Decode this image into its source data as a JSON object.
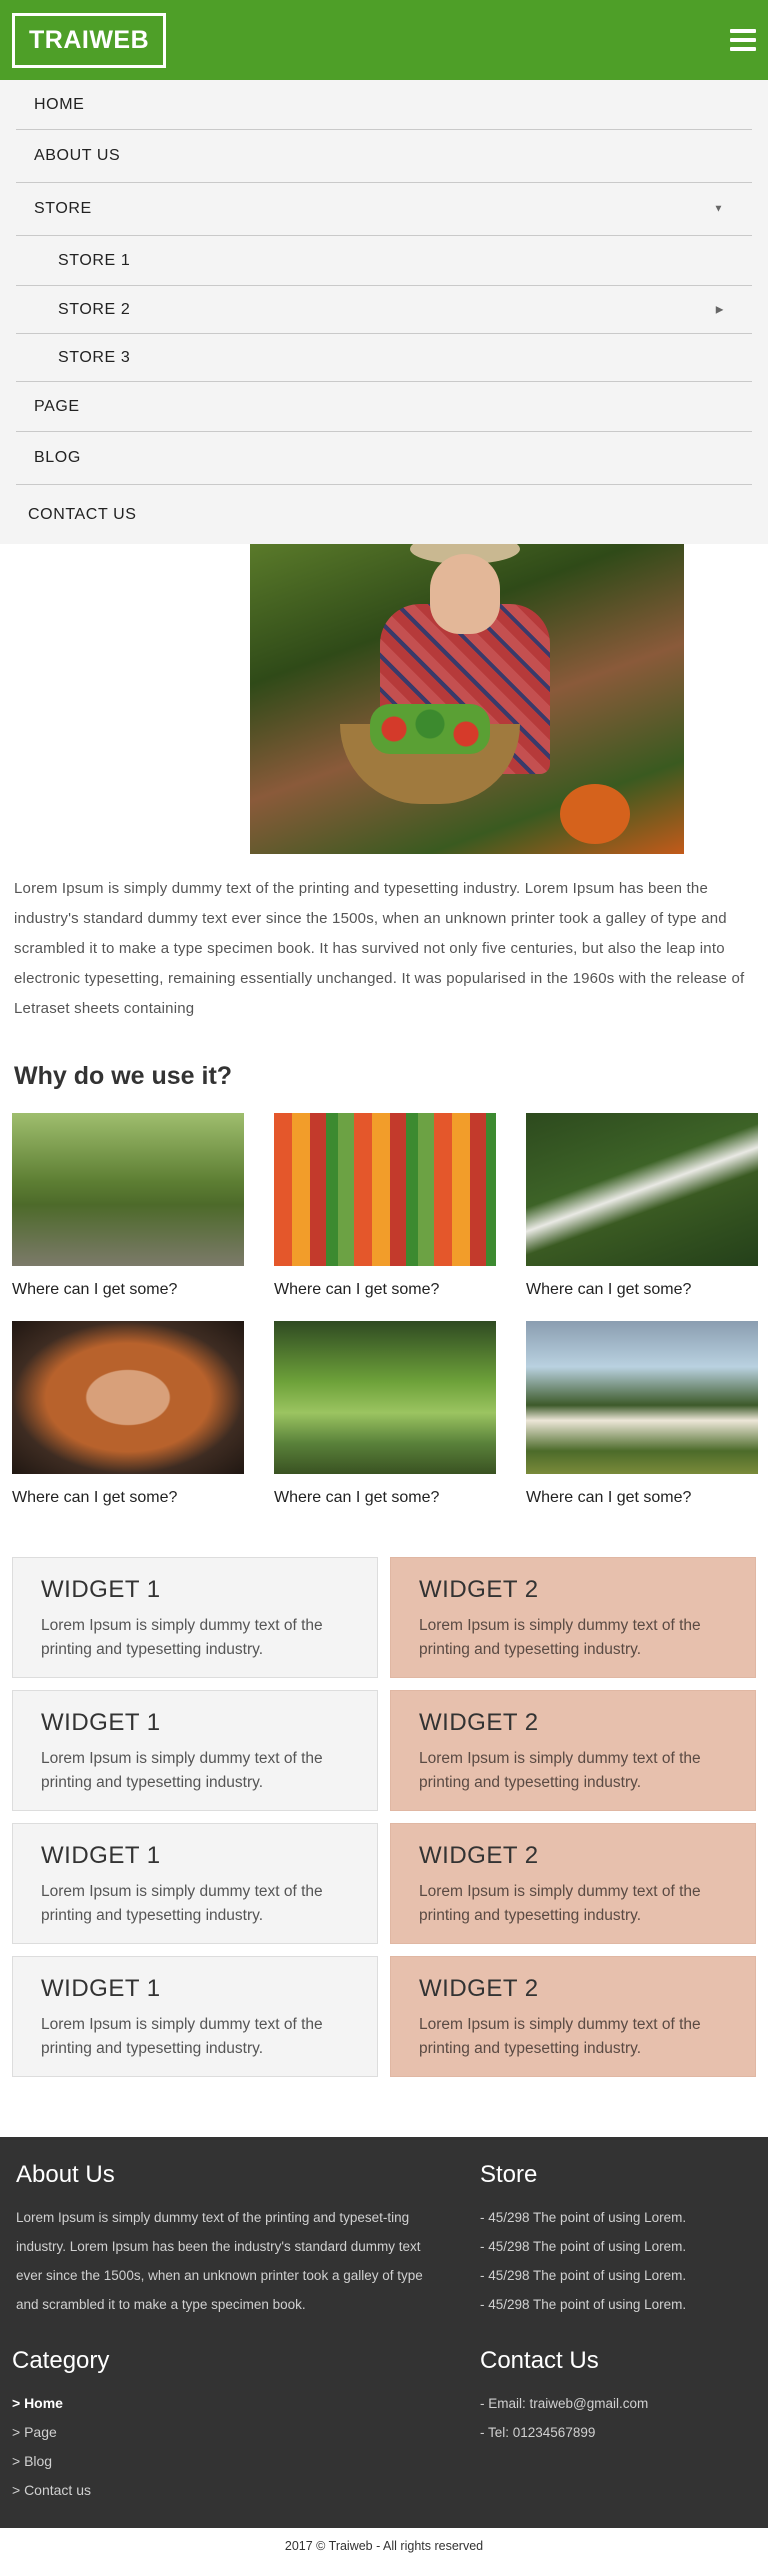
{
  "header": {
    "logo": "TRAIWEB",
    "menu_icon": "hamburger-menu-icon"
  },
  "nav": {
    "items": [
      {
        "label": "HOME",
        "level": 0
      },
      {
        "label": "ABOUT US",
        "level": 0
      },
      {
        "label": "STORE",
        "level": 0,
        "caret": "▼"
      },
      {
        "label": "STORE 1",
        "level": 1
      },
      {
        "label": "STORE 2",
        "level": 1,
        "caret": "▶"
      },
      {
        "label": "STORE 3",
        "level": 1
      },
      {
        "label": "PAGE",
        "level": 0
      },
      {
        "label": "BLOG",
        "level": 0
      },
      {
        "label": "CONTACT US",
        "level": 0
      }
    ]
  },
  "main": {
    "intro": "Lorem Ipsum is simply dummy text of the printing and typesetting industry. Lorem Ipsum has been the industry's standard dummy text ever since the 1500s, when an unknown printer took a galley of type and scrambled it to make a type specimen book. It has survived not only five centuries, but also the leap into electronic typesetting, remaining essentially unchanged. It was popularised in the 1960s with the release of Letraset sheets containing",
    "section_title": "Why do we use it?",
    "gallery": [
      {
        "caption": "Where can I get some?"
      },
      {
        "caption": "Where can I get some?"
      },
      {
        "caption": "Where can I get some?"
      },
      {
        "caption": "Where can I get some?"
      },
      {
        "caption": "Where can I get some?"
      },
      {
        "caption": "Where can I get some?"
      }
    ]
  },
  "widgets": [
    {
      "title": "WIDGET 1",
      "text": "Lorem Ipsum is simply dummy text of the printing and typesetting industry.",
      "color": "#f4f4f4"
    },
    {
      "title": "WIDGET 2",
      "text": "Lorem Ipsum is simply dummy text of the printing and typesetting industry.",
      "color": "#e7c0ad"
    },
    {
      "title": "WIDGET 1",
      "text": "Lorem Ipsum is simply dummy text of the printing and typesetting industry.",
      "color": "#f4f4f4"
    },
    {
      "title": "WIDGET 2",
      "text": "Lorem Ipsum is simply dummy text of the printing and typesetting industry.",
      "color": "#e7c0ad"
    },
    {
      "title": "WIDGET 1",
      "text": "Lorem Ipsum is simply dummy text of the printing and typesetting industry.",
      "color": "#f4f4f4"
    },
    {
      "title": "WIDGET 2",
      "text": "Lorem Ipsum is simply dummy text of the printing and typesetting industry.",
      "color": "#e7c0ad"
    },
    {
      "title": "WIDGET 1",
      "text": "Lorem Ipsum is simply dummy text of the printing and typesetting industry.",
      "color": "#f4f4f4"
    },
    {
      "title": "WIDGET 2",
      "text": "Lorem Ipsum is simply dummy text of the printing and typesetting industry.",
      "color": "#e7c0ad"
    }
  ],
  "footer": {
    "about": {
      "title": "About Us",
      "text": "Lorem Ipsum is simply dummy text of the printing and typeset-ting industry. Lorem Ipsum has been the industry's standard dummy text ever since the 1500s, when an unknown printer took a galley of type and scrambled it to make a type specimen book."
    },
    "store": {
      "title": "Store",
      "items": [
        "- 45/298 The point of using Lorem.",
        "- 45/298 The point of using Lorem.",
        "- 45/298 The point of using Lorem.",
        "- 45/298 The point of using Lorem."
      ]
    },
    "category": {
      "title": "Category",
      "items": [
        "> Home",
        "> Page",
        "> Blog",
        "> Contact us"
      ]
    },
    "contact": {
      "title": "Contact Us",
      "email": "- Email: traiweb@gmail.com",
      "tel": "- Tel: 01234567899"
    },
    "copyright": "2017 © Traiweb - All rights reserved"
  },
  "colors": {
    "header_bg": "#4e9f28",
    "footer_bg": "#333333",
    "widget2_bg": "#e7c0ad"
  }
}
